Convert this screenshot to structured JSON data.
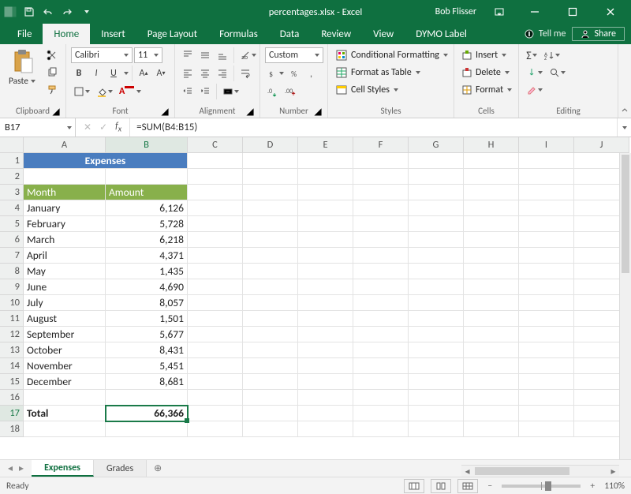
{
  "titlebar": {
    "title": "percentages.xlsx - Excel",
    "user": "Bob Flisser"
  },
  "tabs": {
    "file": "File",
    "home": "Home",
    "insert": "Insert",
    "page_layout": "Page Layout",
    "formulas": "Formulas",
    "data": "Data",
    "review": "Review",
    "view": "View",
    "dymo": "DYMO Label",
    "tellme": "Tell me",
    "share": "Share"
  },
  "ribbon": {
    "clipboard": {
      "title": "Clipboard",
      "paste": "Paste"
    },
    "font": {
      "title": "Font",
      "name": "Calibri",
      "size": "11",
      "bold": "B",
      "italic": "I",
      "underline": "U"
    },
    "alignment": {
      "title": "Alignment"
    },
    "number": {
      "title": "Number",
      "format": "Custom"
    },
    "styles": {
      "title": "Styles",
      "conditional": "Conditional Formatting",
      "table": "Format as Table",
      "cell_styles": "Cell Styles"
    },
    "cells": {
      "title": "Cells",
      "insert": "Insert",
      "delete": "Delete",
      "format": "Format"
    },
    "editing": {
      "title": "Editing"
    }
  },
  "fx": {
    "namebox": "B17",
    "formula": "=SUM(B4:B15)"
  },
  "columns": [
    "A",
    "B",
    "C",
    "D",
    "E",
    "F",
    "G",
    "H",
    "I",
    "J"
  ],
  "sheet": {
    "title": "Expenses",
    "header_month": "Month",
    "header_amount": "Amount",
    "rows": [
      {
        "m": "January",
        "v": "6,126"
      },
      {
        "m": "February",
        "v": "5,728"
      },
      {
        "m": "March",
        "v": "6,218"
      },
      {
        "m": "April",
        "v": "4,371"
      },
      {
        "m": "May",
        "v": "1,435"
      },
      {
        "m": "June",
        "v": "4,690"
      },
      {
        "m": "July",
        "v": "8,057"
      },
      {
        "m": "August",
        "v": "1,501"
      },
      {
        "m": "September",
        "v": "5,677"
      },
      {
        "m": "October",
        "v": "8,431"
      },
      {
        "m": "November",
        "v": "5,451"
      },
      {
        "m": "December",
        "v": "8,681"
      }
    ],
    "total_label": "Total",
    "total_value": "66,366"
  },
  "sheet_tabs": {
    "active": "Expenses",
    "other": "Grades"
  },
  "status": {
    "ready": "Ready",
    "zoom": "110%"
  }
}
